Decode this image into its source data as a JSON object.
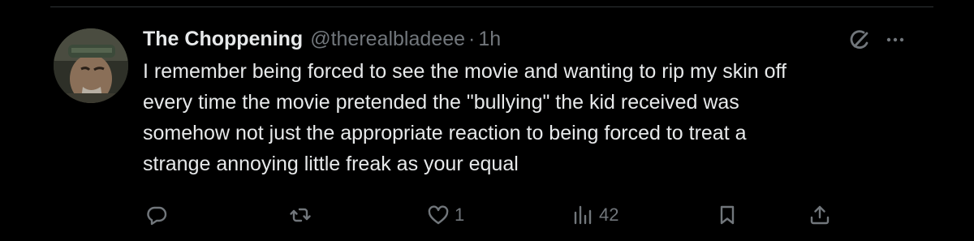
{
  "tweet": {
    "author": {
      "display_name": "The Choppening",
      "handle": "@therealbladeee",
      "separator": "·",
      "time": "1h"
    },
    "text_lines": [
      "I remember being forced to see the movie and wanting to rip my skin off",
      "every time the movie pretended the \"bullying\" the kid received was",
      "somehow not just the appropriate reaction to being forced to treat a",
      "strange annoying little freak as your equal"
    ],
    "actions": {
      "reply": {
        "icon": "reply-icon",
        "count": ""
      },
      "repost": {
        "icon": "repost-icon",
        "count": ""
      },
      "like": {
        "icon": "heart-icon",
        "count": "1"
      },
      "views": {
        "icon": "views-icon",
        "count": "42"
      },
      "bookmark": {
        "icon": "bookmark-icon"
      },
      "share": {
        "icon": "share-icon"
      }
    },
    "header_icons": [
      "grok-icon",
      "more-icon"
    ]
  },
  "colors": {
    "background": "#000000",
    "text_primary": "#e7e9ea",
    "text_secondary": "#71767b",
    "divider": "#2f3336"
  }
}
